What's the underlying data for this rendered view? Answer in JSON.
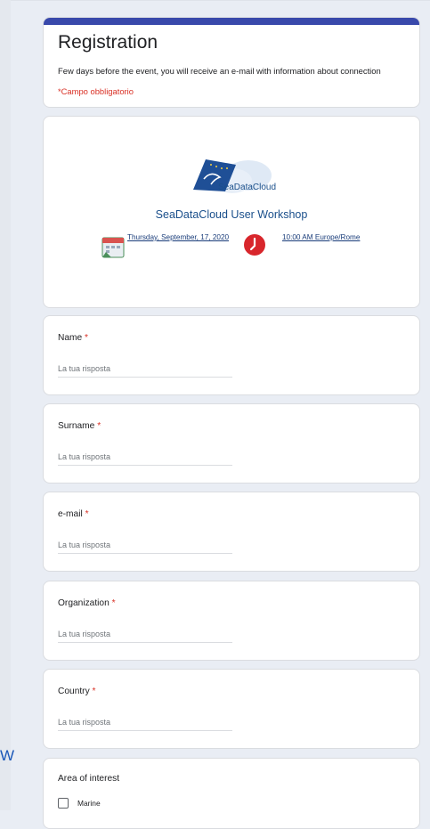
{
  "form": {
    "title": "Registration",
    "description": "Few days before the event, you will receive an e-mail with information about connection",
    "required_note": "*Campo obbligatorio",
    "accent_color": "#3949ab"
  },
  "banner": {
    "brand": "SeaDataCloud",
    "event_title": "SeaDataCloud User Workshop",
    "date": "Thursday, September, 17, 2020",
    "time": "10:00 AM Europe/Rome",
    "icons": [
      "calendar-icon",
      "clock-icon"
    ]
  },
  "questions": [
    {
      "label": "Name",
      "required": "*",
      "placeholder": "La tua risposta"
    },
    {
      "label": "Surname",
      "required": "*",
      "placeholder": "La tua risposta"
    },
    {
      "label": "e-mail",
      "required": "*",
      "placeholder": "La tua risposta"
    },
    {
      "label": "Organization",
      "required": "*",
      "placeholder": "La tua risposta"
    },
    {
      "label": "Country",
      "required": "*",
      "placeholder": "La tua risposta"
    }
  ],
  "interest": {
    "label": "Area of interest",
    "options": [
      "Marine"
    ]
  },
  "edge_fragment": "W"
}
